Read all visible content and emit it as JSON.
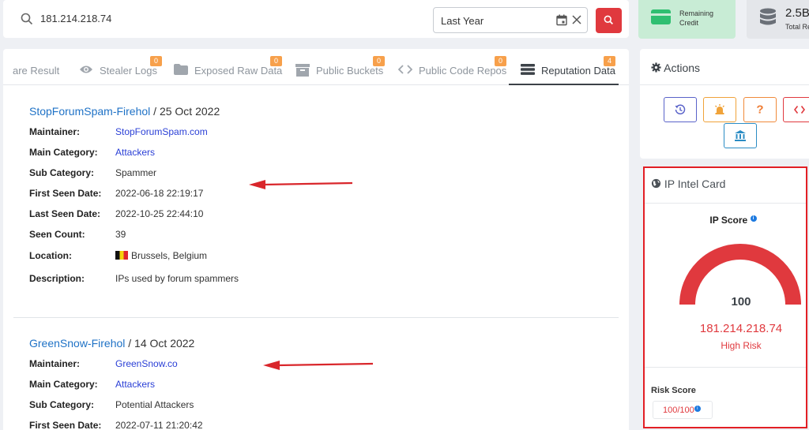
{
  "search": {
    "query": "181.214.218.74",
    "date_range": "Last Year",
    "icons": [
      "search-icon",
      "calendar-icon",
      "close-icon"
    ]
  },
  "credit": {
    "label": "Remaining Credit"
  },
  "records": {
    "value": "2.5B",
    "label": "Total Re"
  },
  "tabs": [
    {
      "label": "are Result",
      "icon": "none",
      "badge": null
    },
    {
      "label": "Stealer Logs",
      "icon": "eye-icon",
      "badge": "0"
    },
    {
      "label": "Exposed Raw Data",
      "icon": "folder-icon",
      "badge": "0"
    },
    {
      "label": "Public Buckets",
      "icon": "archive-icon",
      "badge": "0"
    },
    {
      "label": "Public Code Repos",
      "icon": "code-icon",
      "badge": "0"
    },
    {
      "label": "Reputation Data",
      "icon": "server-icon",
      "badge": "4",
      "active": true
    }
  ],
  "records_list": [
    {
      "source": "StopForumSpam-Firehol",
      "date": "/ 25 Oct 2022",
      "fields": [
        {
          "key": "Maintainer:",
          "value": "StopForumSpam.com",
          "link": true
        },
        {
          "key": "Main Category:",
          "value": "Attackers",
          "link": true
        },
        {
          "key": "Sub Category:",
          "value": "Spammer"
        },
        {
          "key": "First Seen Date:",
          "value": "2022-06-18 22:19:17"
        },
        {
          "key": "Last Seen Date:",
          "value": "2022-10-25 22:44:10"
        },
        {
          "key": "Seen Count:",
          "value": "39"
        },
        {
          "key": "Location:",
          "value": "Brussels, Belgium",
          "flag": true
        },
        {
          "key": "Description:",
          "value": "IPs used by forum spammers"
        }
      ]
    },
    {
      "source": "GreenSnow-Firehol",
      "date": "/ 14 Oct 2022",
      "fields": [
        {
          "key": "Maintainer:",
          "value": "GreenSnow.co",
          "link": true
        },
        {
          "key": "Main Category:",
          "value": "Attackers",
          "link": true
        },
        {
          "key": "Sub Category:",
          "value": "Potential Attackers"
        },
        {
          "key": "First Seen Date:",
          "value": "2022-07-11 21:20:42"
        }
      ]
    }
  ],
  "actions": {
    "title": "Actions"
  },
  "intel": {
    "title": "IP Intel Card",
    "ip_score_label": "IP Score",
    "score": "100",
    "score_fraction": 1.0,
    "ip": "181.214.218.74",
    "risk": "High Risk",
    "risk_score_label": "Risk Score",
    "risk_score": "100/100"
  },
  "colors": {
    "accent_red": "#e0393e",
    "link_blue": "#1f72c6",
    "badge_orange": "#f7a04b",
    "credit_green": "#2fbf71"
  }
}
